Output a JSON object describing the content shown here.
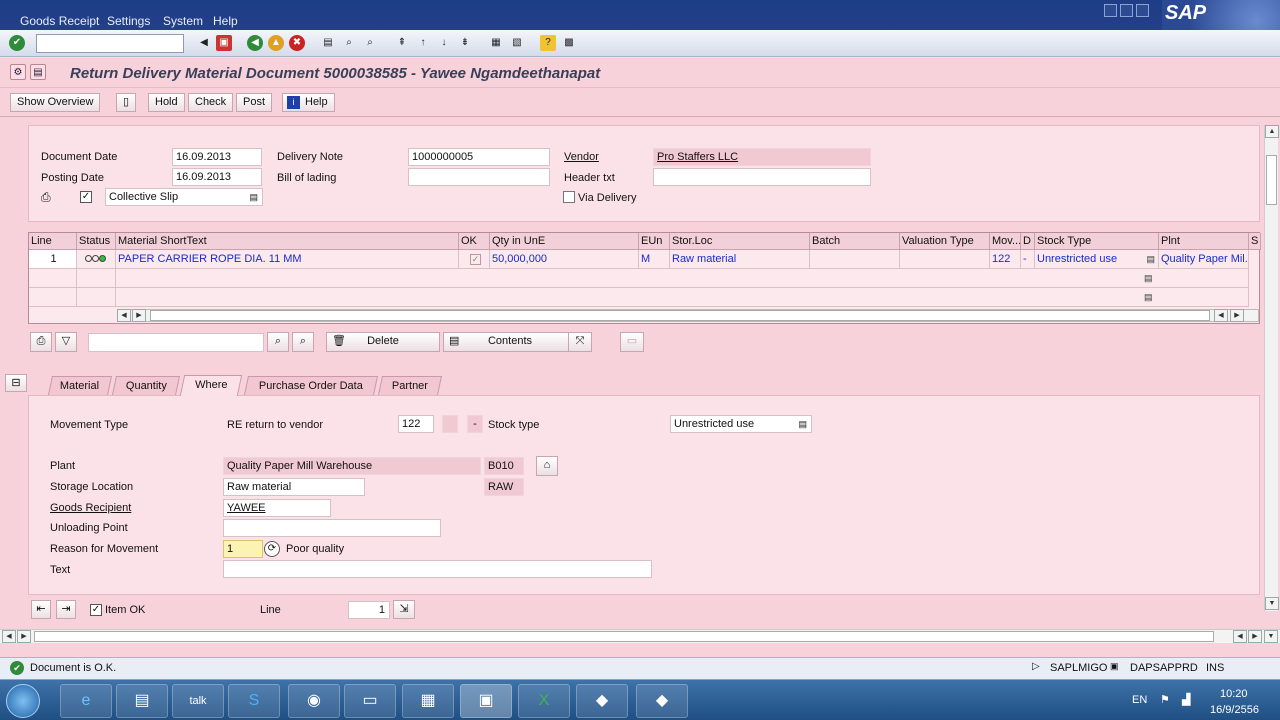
{
  "menu": {
    "items": [
      "Goods Receipt",
      "Settings",
      "System",
      "Help"
    ]
  },
  "brand": "SAP",
  "title": "Return Delivery Material Document 5000038585 - Yawee Ngamdeethanapat",
  "app_toolbar": {
    "show_overview": "Show Overview",
    "hold": "Hold",
    "check": "Check",
    "post": "Post",
    "help": "Help"
  },
  "header": {
    "document_date_label": "Document Date",
    "document_date": "16.09.2013",
    "posting_date_label": "Posting Date",
    "posting_date": "16.09.2013",
    "delivery_note_label": "Delivery Note",
    "delivery_note": "1000000005",
    "bill_of_lading_label": "Bill of lading",
    "bill_of_lading": "",
    "vendor_label": "Vendor",
    "vendor": "Pro Staffers LLC",
    "header_txt_label": "Header txt",
    "header_txt": "",
    "collective_slip": "Collective Slip",
    "via_delivery": "Via Delivery"
  },
  "grid": {
    "columns": [
      "Line",
      "Status",
      "Material ShortText",
      "OK",
      "Qty in UnE",
      "EUn",
      "Stor.Loc",
      "Batch",
      "Valuation Type",
      "Mov...",
      "D",
      "Stock Type",
      "Plnt",
      "S"
    ],
    "row": {
      "line": "1",
      "material": "PAPER CARRIER ROPE DIA. 11 MM",
      "qty": "50,000,000",
      "eun": "M",
      "storloc": "Raw material",
      "mov": "122",
      "d": "-",
      "stock_type": "Unrestricted use",
      "plant": "Quality Paper Mil..."
    }
  },
  "grid_toolbar": {
    "delete": "Delete",
    "contents": "Contents"
  },
  "tabs": [
    "Material",
    "Quantity",
    "Where",
    "Purchase Order Data",
    "Partner"
  ],
  "where": {
    "movement_type_label": "Movement Type",
    "movement_type_text": "RE return to vendor",
    "movement_type": "122",
    "movement_dash": "-",
    "stock_type_label": "Stock type",
    "stock_type": "Unrestricted use",
    "plant_label": "Plant",
    "plant": "Quality Paper Mill Warehouse",
    "plant_code": "B010",
    "storage_location_label": "Storage Location",
    "storage_location": "Raw material",
    "storage_location_code": "RAW",
    "goods_recipient_label": "Goods Recipient",
    "goods_recipient": "YAWEE",
    "unloading_point_label": "Unloading Point",
    "unloading_point": "",
    "reason_label": "Reason for Movement",
    "reason": "1",
    "reason_text": "Poor quality",
    "text_label": "Text",
    "text": ""
  },
  "footer": {
    "item_ok": "Item OK",
    "line_label": "Line",
    "line": "1"
  },
  "status": {
    "message": "Document is O.K.",
    "program": "SAPLMIGO",
    "system": "DAPSAPPRD",
    "mode": "INS"
  },
  "taskbar": {
    "lang": "EN",
    "time": "10:20",
    "date": "16/9/2556"
  }
}
